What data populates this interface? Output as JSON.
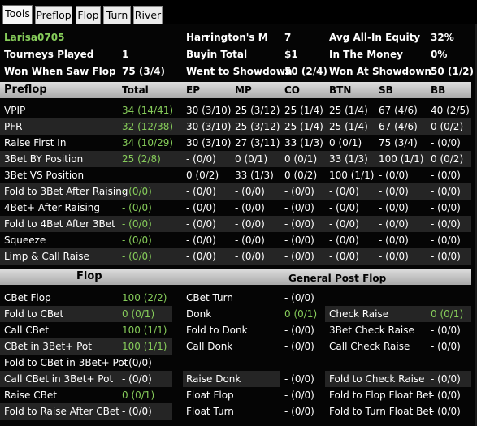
{
  "tabs": [
    "Tools",
    "Preflop",
    "Flop",
    "Turn",
    "River"
  ],
  "summary": {
    "player": "Larisa0705",
    "rows": [
      [
        "",
        "Harrington's M",
        "7",
        "Avg All-In Equity",
        "32%"
      ],
      [
        "Tourneys Played",
        "1",
        "Buyin Total",
        "$1",
        "In The Money",
        "0%"
      ],
      [
        "Won When Saw Flop",
        "75 (3/4)",
        "Went to Showdown",
        "50 (2/4)",
        "Won At Showdown",
        "50 (1/2)"
      ]
    ]
  },
  "preflop": {
    "header": [
      "Preflop",
      "Total",
      "EP",
      "MP",
      "CO",
      "BTN",
      "SB",
      "BB"
    ],
    "rows": [
      [
        "VPIP",
        "34 (14/41)",
        "30 (3/10)",
        "25 (3/12)",
        "25 (1/4)",
        "25 (1/4)",
        "67 (4/6)",
        "40 (2/5)"
      ],
      [
        "PFR",
        "32 (12/38)",
        "30 (3/10)",
        "25 (3/12)",
        "25 (1/4)",
        "25 (1/4)",
        "67 (4/6)",
        "0 (0/2)"
      ],
      [
        "Raise First In",
        "34 (10/29)",
        "30 (3/10)",
        "27 (3/11)",
        "33 (1/3)",
        "0 (0/1)",
        "75 (3/4)",
        "- (0/0)"
      ],
      [
        "3Bet BY Position",
        "25 (2/8)",
        "- (0/0)",
        "0 (0/1)",
        "0 (0/1)",
        "33 (1/3)",
        "100 (1/1)",
        "0 (0/2)"
      ],
      [
        "3Bet VS Position",
        "",
        "0 (0/2)",
        "33 (1/3)",
        "0 (0/2)",
        "100 (1/1)",
        "- (0/0)",
        "- (0/0)"
      ],
      [
        "Fold to 3Bet After Raising",
        "- (0/0)",
        "- (0/0)",
        "- (0/0)",
        "- (0/0)",
        "- (0/0)",
        "- (0/0)",
        "- (0/0)"
      ],
      [
        "4Bet+ After Raising",
        "- (0/0)",
        "- (0/0)",
        "- (0/0)",
        "- (0/0)",
        "- (0/0)",
        "- (0/0)",
        "- (0/0)"
      ],
      [
        "Fold to 4Bet After 3Bet",
        "- (0/0)",
        "- (0/0)",
        "- (0/0)",
        "- (0/0)",
        "- (0/0)",
        "- (0/0)",
        "- (0/0)"
      ],
      [
        "Squeeze",
        "- (0/0)",
        "- (0/0)",
        "- (0/0)",
        "- (0/0)",
        "- (0/0)",
        "- (0/0)",
        "- (0/0)"
      ],
      [
        "Limp & Call Raise",
        "- (0/0)",
        "- (0/0)",
        "- (0/0)",
        "- (0/0)",
        "- (0/0)",
        "- (0/0)",
        "- (0/0)"
      ]
    ]
  },
  "flop_section": {
    "header_left": "Flop",
    "header_right": "General Post Flop",
    "rows": [
      [
        "CBet Flop",
        "100 (2/2)",
        "CBet Turn",
        "- (0/0)",
        "",
        ""
      ],
      [
        "Fold to CBet",
        "0 (0/1)",
        "Donk",
        "0 (0/1)",
        "Check Raise",
        "0 (0/1)"
      ],
      [
        "Call CBet",
        "100 (1/1)",
        "Fold to Donk",
        "- (0/0)",
        "3Bet Check Raise",
        "- (0/0)"
      ],
      [
        "CBet in 3Bet+ Pot",
        "100 (1/1)",
        "Call Donk",
        "- (0/0)",
        "Call Check Raise",
        "- (0/0)"
      ],
      [
        "Fold to CBet in 3Bet+ Pot",
        "- (0/0)",
        "",
        "",
        "",
        ""
      ],
      [
        "Call CBet in 3Bet+ Pot",
        "- (0/0)",
        "Raise Donk",
        "- (0/0)",
        "Fold to Check Raise",
        "- (0/0)"
      ],
      [
        "Raise CBet",
        "0 (0/1)",
        "Float Flop",
        "- (0/0)",
        "Fold to Flop Float Bet",
        "- (0/0)"
      ],
      [
        "Fold to Raise After CBet",
        "- (0/0)",
        "Float Turn",
        "- (0/0)",
        "Fold to Turn Float Bet",
        "- (0/0)"
      ]
    ]
  },
  "colors": {
    "accent_green": "#86cc5a",
    "row_alt": "#252525",
    "header_bar": "#c4c4c4"
  }
}
